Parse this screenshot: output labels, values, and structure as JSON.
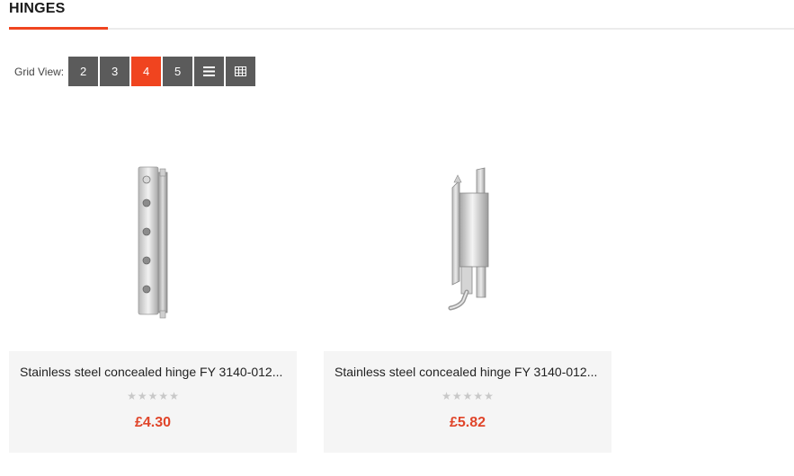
{
  "header": {
    "title": "HINGES"
  },
  "grid_view": {
    "label": "Grid View:",
    "options": [
      "2",
      "3",
      "4",
      "5"
    ],
    "active": "4",
    "list_icon": "list-icon",
    "table_icon": "table-icon"
  },
  "products": [
    {
      "name": "Stainless steel concealed hinge FY 3140-012...",
      "price": "£4.30",
      "rating": 0,
      "stars": 5
    },
    {
      "name": "Stainless steel concealed hinge FY 3140-012...",
      "price": "£5.82",
      "rating": 0,
      "stars": 5
    }
  ],
  "colors": {
    "accent": "#f0441f",
    "button": "#5b5b5b",
    "price": "#e0452a",
    "card_bg": "#f5f5f5",
    "star_empty": "#c8c8c8"
  }
}
